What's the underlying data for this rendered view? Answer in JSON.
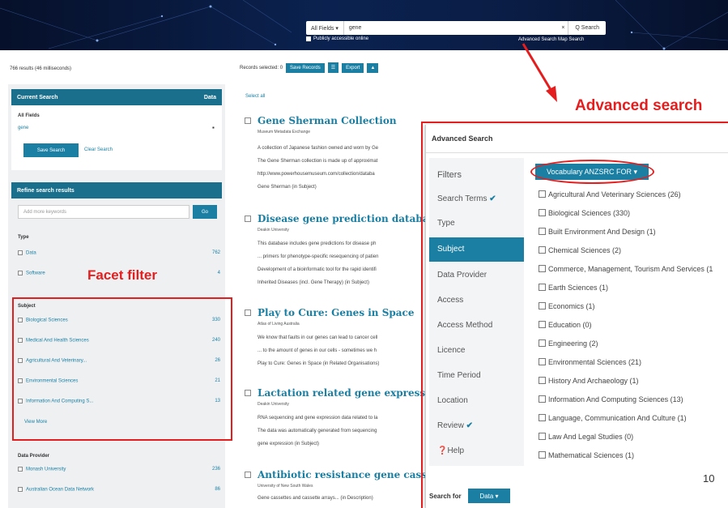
{
  "header": {
    "fields_select": "All Fields ▾",
    "query": "gene",
    "clear": "×",
    "search_button": "Q Search",
    "public_label": "Publicly accessible online",
    "adv_links": "Advanced Search  Map Search"
  },
  "results_bar": {
    "count_text": "766 results (46 milliseconds)",
    "records_selected": "Records selected: 0",
    "save_records": "Save Records",
    "export": "Export"
  },
  "current_search": {
    "title": "Current Search",
    "data_tag": "Data",
    "all_fields_label": "All Fields",
    "term": "gene",
    "remove": "▪",
    "save_search": "Save Search",
    "clear_search": "Clear Search"
  },
  "refine": {
    "title": "Refine search results",
    "placeholder": "Add more keywords",
    "go": "Go",
    "type_label": "Type",
    "types": [
      {
        "label": "Data",
        "count": "762"
      },
      {
        "label": "Software",
        "count": "4"
      }
    ],
    "subject_label": "Subject",
    "subjects": [
      {
        "label": "Biological Sciences",
        "count": "330"
      },
      {
        "label": "Medical And Health Sciences",
        "count": "240"
      },
      {
        "label": "Agricultural And Veterinary...",
        "count": "26"
      },
      {
        "label": "Environmental Sciences",
        "count": "21"
      },
      {
        "label": "Information And Computing S...",
        "count": "13"
      }
    ],
    "view_more": "View More",
    "provider_label": "Data Provider",
    "providers": [
      {
        "label": "Monash University",
        "count": "236"
      },
      {
        "label": "Australian Ocean Data Network",
        "count": "86"
      }
    ]
  },
  "annotations": {
    "facet": "Facet filter",
    "advanced": "Advanced search"
  },
  "results": {
    "select_all": "Select all",
    "items": [
      {
        "title": "Gene Sherman Collection",
        "source": "Museum Metadata Exchange",
        "lines": [
          "A collection of Japanese fashion owned and worn by Ge",
          "The Gene Sherman collection is made up of approximat",
          "http://www.powerhousemuseum.com/collection/databa",
          "Gene Sherman (in Subject)"
        ]
      },
      {
        "title": "Disease gene prediction database",
        "source": "Deakin University",
        "lines": [
          "This database includes gene predictions for disease ph",
          "... primers for phenotype-specific resequencing of patien",
          "Development of a bioinformatic tool for the rapid identifi",
          "Inherited Diseases (incl. Gene Therapy) (in Subject)"
        ]
      },
      {
        "title": "Play to Cure: Genes in Space",
        "source": "Atlas of Living Australia",
        "lines": [
          "We know that faults in our genes can lead to cancer cell",
          "... to the amount of genes in our cells - sometimes we h",
          "Play to Cure: Genes in Space (in Related Organisations)"
        ]
      },
      {
        "title": "Lactation related gene expression d",
        "source": "Deakin University",
        "lines": [
          "RNA sequencing and gene expression data related to la",
          "The data was automatically generated from sequencing",
          "gene expression (in Subject)"
        ]
      },
      {
        "title": "Antibiotic resistance gene cassettes",
        "source": "University of New South Wales",
        "lines": [
          "Gene cassettes and cassette arrays... (in Description)"
        ]
      }
    ]
  },
  "advanced": {
    "title": "Advanced Search",
    "filters_label": "Filters",
    "filters": [
      {
        "label": "Search Terms",
        "check": "✔"
      },
      {
        "label": "Type",
        "check": ""
      },
      {
        "label": "Subject",
        "check": ""
      },
      {
        "label": "Data Provider",
        "check": ""
      },
      {
        "label": "Access",
        "check": ""
      },
      {
        "label": "Access Method",
        "check": ""
      },
      {
        "label": "Licence",
        "check": ""
      },
      {
        "label": "Time Period",
        "check": ""
      },
      {
        "label": "Location",
        "check": ""
      },
      {
        "label": "Review",
        "check": "✔"
      },
      {
        "label": "Help",
        "check": ""
      }
    ],
    "vocab_button": "Vocabulary ANZSRC FOR ▾",
    "subjects": [
      "Agricultural And Veterinary Sciences (26)",
      "Biological Sciences (330)",
      "Built Environment And Design (1)",
      "Chemical Sciences (2)",
      "Commerce, Management, Tourism And Services (1",
      "Earth Sciences (1)",
      "Economics (1)",
      "Education (0)",
      "Engineering (2)",
      "Environmental Sciences (21)",
      "History And Archaeology (1)",
      "Information And Computing Sciences (13)",
      "Language, Communication And Culture (1)",
      "Law And Legal Studies (0)",
      "Mathematical Sciences (1)"
    ],
    "search_for": "Search for",
    "data_button": "Data ▾",
    "page_number": "10"
  },
  "colors": {
    "accent": "#1a7fa3",
    "annotation": "#e41e1e",
    "panel_head": "#1a6f8c"
  }
}
